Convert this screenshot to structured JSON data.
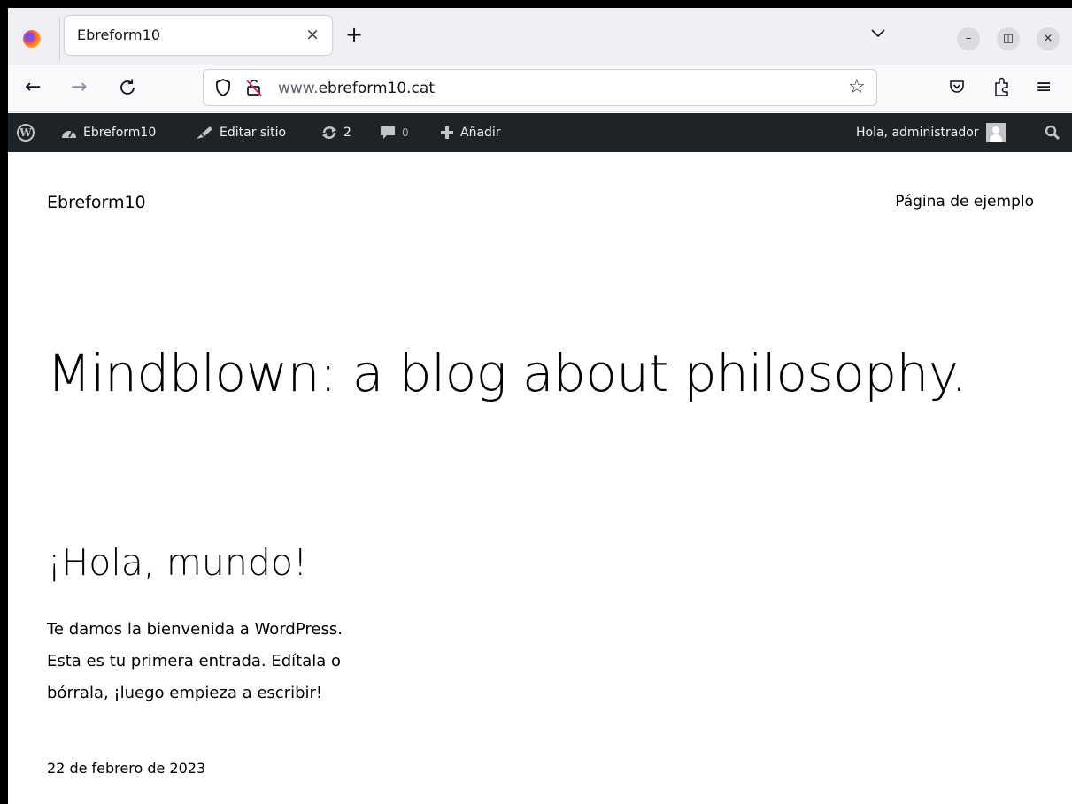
{
  "browser": {
    "tab_title": "Ebreform10",
    "tab_close": "×",
    "new_tab": "+",
    "url_prefix": "www.",
    "url_domain": "ebreform10.cat",
    "icons": {
      "back": "←",
      "forward": "→",
      "reload": "C",
      "shield": "shield-icon",
      "bookmark": "☆",
      "pocket": "pocket-icon",
      "extensions": "extensions-icon",
      "menu": "≡",
      "minimize": "–",
      "restore": "◫",
      "close": "×"
    }
  },
  "adminbar": {
    "site_name": "Ebreform10",
    "edit_site": "Editar sitio",
    "updates_count": "2",
    "comments_count": "0",
    "add_new": "Añadir",
    "greeting": "Hola, administrador"
  },
  "site": {
    "title": "Ebreform10",
    "nav_link": "Página de ejemplo",
    "tagline": "Mindblown: a blog about philosophy."
  },
  "post": {
    "title": "¡Hola, mundo!",
    "excerpt": "Te damos la bienvenida a WordPress. Esta es tu primera entrada. Edítala o bórrala, ¡luego empieza a escribir!",
    "date": "22 de febrero de 2023"
  },
  "colors": {
    "adminbar_bg": "#1d2327",
    "tabbar_bg": "#f0f0f4",
    "navbar_bg": "#f9f9fb"
  }
}
